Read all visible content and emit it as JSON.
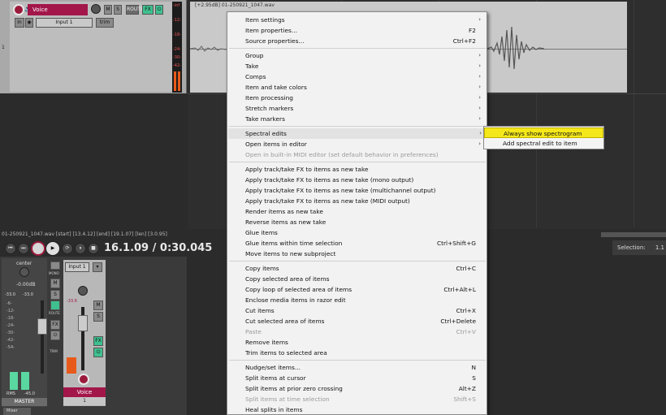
{
  "track": {
    "name": "Voice",
    "number": "1",
    "input": "Input 1",
    "buttons": {
      "mute": "M",
      "solo": "S",
      "route": "ROUTE",
      "fx": "FX"
    },
    "meter_labels": [
      "-inf",
      "-12-",
      "-18-",
      "-24-",
      "-30-",
      "-42-"
    ]
  },
  "arrange": {
    "item_header": "[+2.95dB] 01-250921_1047.wav"
  },
  "transport": {
    "status": "01-250921_1047.wav [start] [13.4.12] [end] [19.1.07] [len] [3.0.95]",
    "time": "16.1.09 / 0:30.045",
    "selection_label": "Selection:",
    "selection_value": "1.1"
  },
  "mixer": {
    "master": {
      "pan": "center",
      "volume": "-0.00dB",
      "peaks": [
        "-33.0",
        "-33.0"
      ],
      "label": "MASTER",
      "rms": "RMS",
      "rms_value": "-45.0",
      "scale": [
        "-6-",
        "-12-",
        "-18-",
        "-24-",
        "-30-",
        "-42-",
        "-54-"
      ],
      "side_buttons": [
        "MONO",
        "M",
        "S",
        "ROUTE",
        "FX",
        "TRIM"
      ]
    },
    "voice": {
      "input": "Input 1",
      "label": "Voice",
      "number": "1",
      "buttons": {
        "mute": "M",
        "solo": "S",
        "fx": "FX"
      },
      "peak": "-33.6"
    },
    "tab_label": "Mixer"
  },
  "context_menu": {
    "items": [
      {
        "label": "Item settings",
        "shortcut": "",
        "arrow": true,
        "disabled": false
      },
      {
        "label": "Item properties...",
        "shortcut": "F2",
        "arrow": false,
        "disabled": false
      },
      {
        "label": "Source properties...",
        "shortcut": "Ctrl+F2",
        "arrow": false,
        "disabled": false
      },
      {
        "label": "Group",
        "shortcut": "",
        "arrow": true,
        "disabled": false
      },
      {
        "label": "Take",
        "shortcut": "",
        "arrow": true,
        "disabled": false
      },
      {
        "label": "Comps",
        "shortcut": "",
        "arrow": true,
        "disabled": false
      },
      {
        "label": "Item and take colors",
        "shortcut": "",
        "arrow": true,
        "disabled": false
      },
      {
        "label": "Item processing",
        "shortcut": "",
        "arrow": true,
        "disabled": false
      },
      {
        "label": "Stretch markers",
        "shortcut": "",
        "arrow": true,
        "disabled": false
      },
      {
        "label": "Take markers",
        "shortcut": "",
        "arrow": true,
        "disabled": false
      },
      {
        "label": "Spectral edits",
        "shortcut": "",
        "arrow": true,
        "disabled": false,
        "highlighted": true
      },
      {
        "label": "Open items in editor",
        "shortcut": "",
        "arrow": true,
        "disabled": false
      },
      {
        "label": "Open in built-in MIDI editor (set default behavior in preferences)",
        "shortcut": "",
        "arrow": false,
        "disabled": true
      },
      {
        "label": "Apply track/take FX to items as new take",
        "shortcut": "",
        "arrow": false,
        "disabled": false
      },
      {
        "label": "Apply track/take FX to items as new take (mono output)",
        "shortcut": "",
        "arrow": false,
        "disabled": false
      },
      {
        "label": "Apply track/take FX to items as new take (multichannel output)",
        "shortcut": "",
        "arrow": false,
        "disabled": false
      },
      {
        "label": "Apply track/take FX to items as new take (MIDI output)",
        "shortcut": "",
        "arrow": false,
        "disabled": false
      },
      {
        "label": "Render items as new take",
        "shortcut": "",
        "arrow": false,
        "disabled": false
      },
      {
        "label": "Reverse items as new take",
        "shortcut": "",
        "arrow": false,
        "disabled": false
      },
      {
        "label": "Glue items",
        "shortcut": "",
        "arrow": false,
        "disabled": false
      },
      {
        "label": "Glue items within time selection",
        "shortcut": "Ctrl+Shift+G",
        "arrow": false,
        "disabled": false
      },
      {
        "label": "Move items to new subproject",
        "shortcut": "",
        "arrow": false,
        "disabled": false
      },
      {
        "label": "Copy items",
        "shortcut": "Ctrl+C",
        "arrow": false,
        "disabled": false
      },
      {
        "label": "Copy selected area of items",
        "shortcut": "",
        "arrow": false,
        "disabled": false
      },
      {
        "label": "Copy loop of selected area of items",
        "shortcut": "Ctrl+Alt+L",
        "arrow": false,
        "disabled": false
      },
      {
        "label": "Enclose media items in razor edit",
        "shortcut": "",
        "arrow": false,
        "disabled": false
      },
      {
        "label": "Cut items",
        "shortcut": "Ctrl+X",
        "arrow": false,
        "disabled": false
      },
      {
        "label": "Cut selected area of items",
        "shortcut": "Ctrl+Delete",
        "arrow": false,
        "disabled": false
      },
      {
        "label": "Paste",
        "shortcut": "Ctrl+V",
        "arrow": false,
        "disabled": true
      },
      {
        "label": "Remove items",
        "shortcut": "",
        "arrow": false,
        "disabled": false
      },
      {
        "label": "Trim items to selected area",
        "shortcut": "",
        "arrow": false,
        "disabled": false
      },
      {
        "label": "Nudge/set items...",
        "shortcut": "N",
        "arrow": false,
        "disabled": false
      },
      {
        "label": "Split items at cursor",
        "shortcut": "S",
        "arrow": false,
        "disabled": false
      },
      {
        "label": "Split items at prior zero crossing",
        "shortcut": "Alt+Z",
        "arrow": false,
        "disabled": false
      },
      {
        "label": "Split items at time selection",
        "shortcut": "Shift+S",
        "arrow": false,
        "disabled": true
      },
      {
        "label": "Heal splits in items",
        "shortcut": "",
        "arrow": false,
        "disabled": false
      }
    ]
  },
  "submenu": {
    "items": [
      {
        "label": "Always show spectrogram",
        "highlighted": true
      },
      {
        "label": "Add spectral edit to item",
        "highlighted": false
      }
    ]
  },
  "colors": {
    "track_color": "#a3164a",
    "highlight": "#f5e81a",
    "fx_green": "#3fbf8f",
    "meter_orange": "#e85a1a"
  }
}
